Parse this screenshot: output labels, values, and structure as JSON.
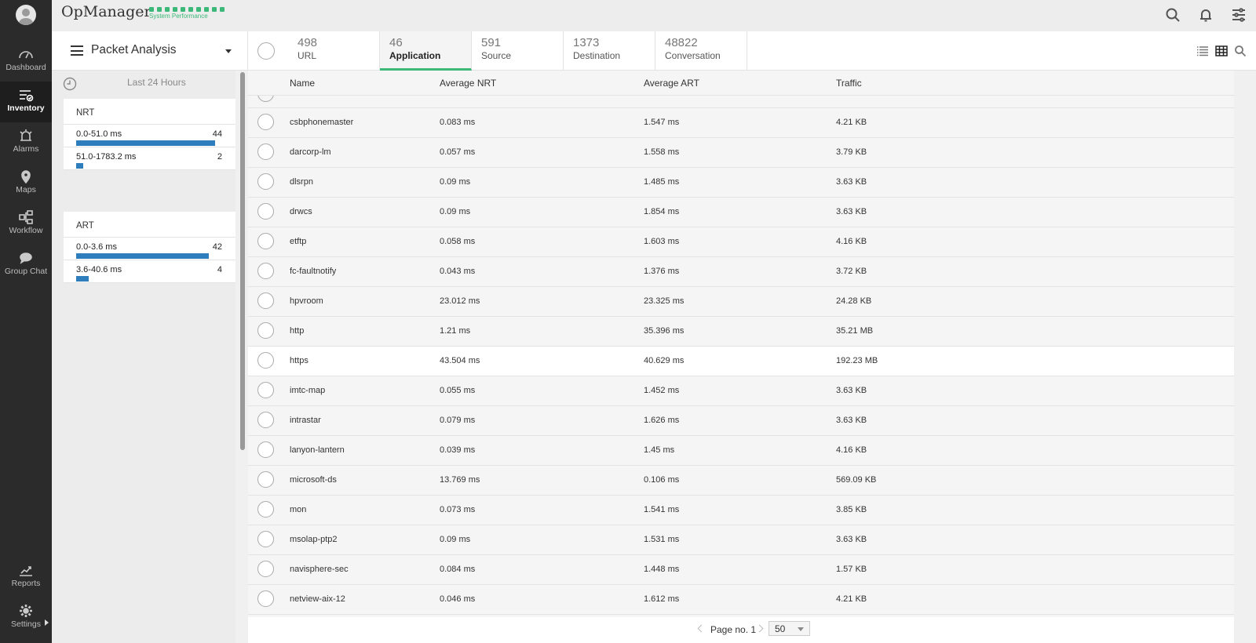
{
  "app": {
    "brand": "OpManager",
    "system_performance_label": "System Performance",
    "accent": "#3cb878",
    "bar_color": "#2e7dbd"
  },
  "nav": {
    "items": [
      {
        "label": "Dashboard",
        "icon": "dashboard-icon"
      },
      {
        "label": "Inventory",
        "icon": "inventory-icon",
        "active": true
      },
      {
        "label": "Alarms",
        "icon": "alarm-icon"
      },
      {
        "label": "Maps",
        "icon": "map-pin-icon"
      },
      {
        "label": "Workflow",
        "icon": "workflow-icon"
      },
      {
        "label": "Group Chat",
        "icon": "chat-icon"
      }
    ],
    "bottom": [
      {
        "label": "Reports",
        "icon": "reports-icon"
      },
      {
        "label": "Settings",
        "icon": "gear-icon"
      }
    ]
  },
  "toolbar": {
    "menu_title": "Packet Analysis",
    "tabs": [
      {
        "count": "498",
        "label": "URL"
      },
      {
        "count": "46",
        "label": "Application",
        "active": true
      },
      {
        "count": "591",
        "label": "Source"
      },
      {
        "count": "1373",
        "label": "Destination"
      },
      {
        "count": "48822",
        "label": "Conversation"
      }
    ]
  },
  "filters": {
    "time_range": "Last 24 Hours",
    "groups": [
      {
        "title": "NRT",
        "rows": [
          {
            "label": "0.0-51.0 ms",
            "count": "44",
            "fraction": 0.957
          },
          {
            "label": "51.0-1783.2 ms",
            "count": "2",
            "fraction": 0.044
          }
        ]
      },
      {
        "title": "ART",
        "rows": [
          {
            "label": "0.0-3.6 ms",
            "count": "42",
            "fraction": 0.913
          },
          {
            "label": "3.6-40.6 ms",
            "count": "4",
            "fraction": 0.087
          }
        ]
      }
    ]
  },
  "table": {
    "columns": [
      "Name",
      "Average NRT",
      "Average ART",
      "Traffic"
    ],
    "rows": [
      {
        "name": "csbphonemaster",
        "nrt": "0.083 ms",
        "art": "1.547 ms",
        "traffic": "4.21 KB"
      },
      {
        "name": "darcorp-lm",
        "nrt": "0.057 ms",
        "art": "1.558 ms",
        "traffic": "3.79 KB"
      },
      {
        "name": "dlsrpn",
        "nrt": "0.09 ms",
        "art": "1.485 ms",
        "traffic": "3.63 KB"
      },
      {
        "name": "drwcs",
        "nrt": "0.09 ms",
        "art": "1.854 ms",
        "traffic": "3.63 KB"
      },
      {
        "name": "etftp",
        "nrt": "0.058 ms",
        "art": "1.603 ms",
        "traffic": "4.16 KB"
      },
      {
        "name": "fc-faultnotify",
        "nrt": "0.043 ms",
        "art": "1.376 ms",
        "traffic": "3.72 KB"
      },
      {
        "name": "hpvroom",
        "nrt": "23.012 ms",
        "art": "23.325 ms",
        "traffic": "24.28 KB"
      },
      {
        "name": "http",
        "nrt": "1.21 ms",
        "art": "35.396 ms",
        "traffic": "35.21 MB"
      },
      {
        "name": "https",
        "nrt": "43.504 ms",
        "art": "40.629 ms",
        "traffic": "192.23 MB",
        "highlighted": true
      },
      {
        "name": "imtc-map",
        "nrt": "0.055 ms",
        "art": "1.452 ms",
        "traffic": "3.63 KB"
      },
      {
        "name": "intrastar",
        "nrt": "0.079 ms",
        "art": "1.626 ms",
        "traffic": "3.63 KB"
      },
      {
        "name": "lanyon-lantern",
        "nrt": "0.039 ms",
        "art": "1.45 ms",
        "traffic": "4.16 KB"
      },
      {
        "name": "microsoft-ds",
        "nrt": "13.769 ms",
        "art": "0.106 ms",
        "traffic": "569.09 KB"
      },
      {
        "name": "mon",
        "nrt": "0.073 ms",
        "art": "1.541 ms",
        "traffic": "3.85 KB"
      },
      {
        "name": "msolap-ptp2",
        "nrt": "0.09 ms",
        "art": "1.531 ms",
        "traffic": "3.63 KB"
      },
      {
        "name": "navisphere-sec",
        "nrt": "0.084 ms",
        "art": "1.448 ms",
        "traffic": "1.57 KB"
      },
      {
        "name": "netview-aix-12",
        "nrt": "0.046 ms",
        "art": "1.612 ms",
        "traffic": "4.21 KB"
      }
    ]
  },
  "pagination": {
    "page_label": "Page no. 1",
    "page_size": "50"
  }
}
